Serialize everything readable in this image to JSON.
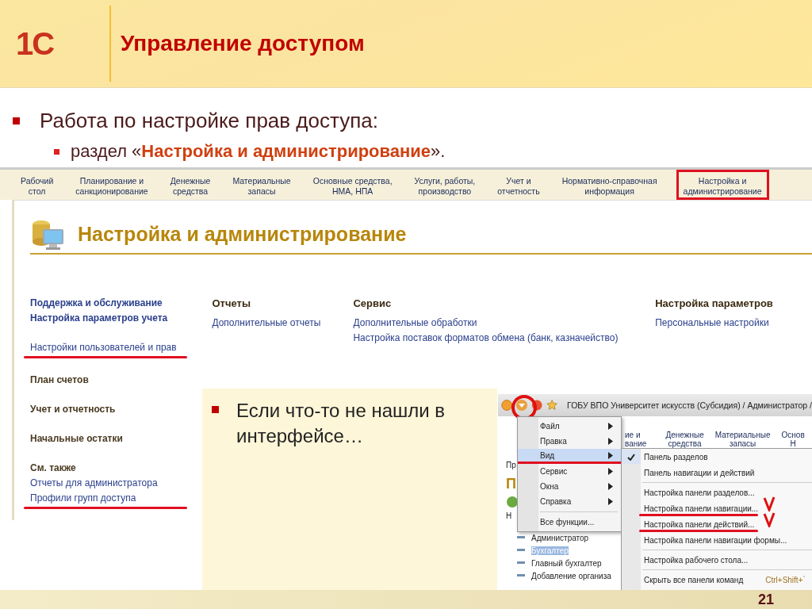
{
  "header": {
    "logo": "1С",
    "title": "Управление доступом"
  },
  "bullets": [
    {
      "text": "Работа по настройке прав доступа:",
      "children": [
        {
          "text": "раздел «**Настройка и администрирование**»."
        }
      ]
    }
  ],
  "screenshot": {
    "sections": [
      {
        "label_lines": [
          "Рабочий",
          "стол"
        ],
        "selected": false
      },
      {
        "label_lines": [
          "Планирование и",
          "санкционирование"
        ],
        "selected": false
      },
      {
        "label_lines": [
          "Денежные",
          "средства"
        ],
        "selected": false
      },
      {
        "label_lines": [
          "Материальные",
          "запасы"
        ],
        "selected": false
      },
      {
        "label_lines": [
          "Основные средства,",
          "НМА, НПА"
        ],
        "selected": false
      },
      {
        "label_lines": [
          "Услуги, работы,",
          "производство"
        ],
        "selected": false
      },
      {
        "label_lines": [
          "Учет и",
          "отчетность"
        ],
        "selected": false
      },
      {
        "label_lines": [
          "Нормативно-справочная",
          "информация"
        ],
        "selected": false
      },
      {
        "label_lines": [
          "Настройка и",
          "администрирование"
        ],
        "selected": true
      }
    ],
    "heading": "Настройка и администрирование",
    "left_groups": [
      [
        {
          "text": "Поддержка и обслуживание",
          "kind": "bold_link",
          "marked": false
        },
        {
          "text": "Настройка параметров учета",
          "kind": "bold_link",
          "marked": false
        }
      ],
      [
        {
          "text": "Настройки пользователей и прав",
          "kind": "link",
          "marked": true
        }
      ],
      [
        {
          "text": "План счетов",
          "kind": "header",
          "marked": false
        }
      ],
      [
        {
          "text": "Учет и отчетность",
          "kind": "header",
          "marked": false
        }
      ],
      [
        {
          "text": "Начальные остатки",
          "kind": "header",
          "marked": false
        }
      ],
      [
        {
          "text": "См. также",
          "kind": "header",
          "marked": false
        },
        {
          "text": "Отчеты для администратора",
          "kind": "link",
          "marked": false
        },
        {
          "text": "Профили групп доступа",
          "kind": "link",
          "marked": true
        }
      ]
    ],
    "columns": [
      {
        "title": "Отчеты",
        "links": [
          "Дополнительные отчеты"
        ]
      },
      {
        "title": "Сервис",
        "links": [
          "Дополнительные обработки",
          "Настройка поставок форматов обмена (банк, казначейство)"
        ]
      },
      {
        "title": "Настройка параметров",
        "links": [
          "Персональные настройки"
        ]
      }
    ]
  },
  "callout": {
    "text": "Если что-то не нашли в интерфейсе…"
  },
  "screenshot_2": {
    "title": "ГОБУ ВПО Университет искусств (Субсидия) / Администратор /",
    "nav_fragments": [
      [
        "ие и",
        "вание"
      ],
      [
        "Денежные",
        "средства"
      ],
      [
        "Материальные",
        "запасы"
      ],
      [
        "Основ",
        "Н"
      ]
    ],
    "tab_fragment": "Пр",
    "heading_fragment": "П",
    "column_fragment": "Н",
    "rows": [
      {
        "text": "Администратор",
        "selected": false
      },
      {
        "text": "Бухгалтер",
        "selected": true
      },
      {
        "text": "Главный бухгалтер",
        "selected": false
      },
      {
        "text": "Добавление организа",
        "selected": false
      }
    ],
    "menu": [
      {
        "kind": "item",
        "label": "Файл",
        "submenu": true,
        "selected": false
      },
      {
        "kind": "item",
        "label": "Правка",
        "submenu": true,
        "selected": false
      },
      {
        "kind": "item",
        "label": "Вид",
        "submenu": true,
        "selected": true
      },
      {
        "kind": "item",
        "label": "Сервис",
        "submenu": true,
        "selected": false
      },
      {
        "kind": "item",
        "label": "Окна",
        "submenu": true,
        "selected": false
      },
      {
        "kind": "item",
        "label": "Справка",
        "submenu": true,
        "selected": false
      },
      {
        "kind": "separator"
      },
      {
        "kind": "item",
        "label": "Все функции...",
        "submenu": false,
        "selected": false
      }
    ],
    "submenu": [
      {
        "kind": "item",
        "label": "Панель разделов",
        "checked": true,
        "marked": false
      },
      {
        "kind": "item",
        "label": "Панель навигации и действий",
        "checked": false,
        "marked": false
      },
      {
        "kind": "separator"
      },
      {
        "kind": "item",
        "label": "Настройка панели разделов...",
        "checked": false,
        "marked": false
      },
      {
        "kind": "item",
        "label": "Настройка панели навигации...",
        "checked": false,
        "marked": true
      },
      {
        "kind": "item",
        "label": "Настройка панели действий...",
        "checked": false,
        "marked": true
      },
      {
        "kind": "item",
        "label": "Настройка панели навигации формы...",
        "checked": false,
        "marked": false
      },
      {
        "kind": "separator"
      },
      {
        "kind": "item",
        "label": "Настройка рабочего стола...",
        "checked": false,
        "marked": false
      },
      {
        "kind": "separator"
      },
      {
        "kind": "item",
        "label": "Скрыть все панели команд",
        "shortcut": "Ctrl+Shift+`",
        "checked": false,
        "marked": false
      }
    ]
  },
  "page_number": "21"
}
